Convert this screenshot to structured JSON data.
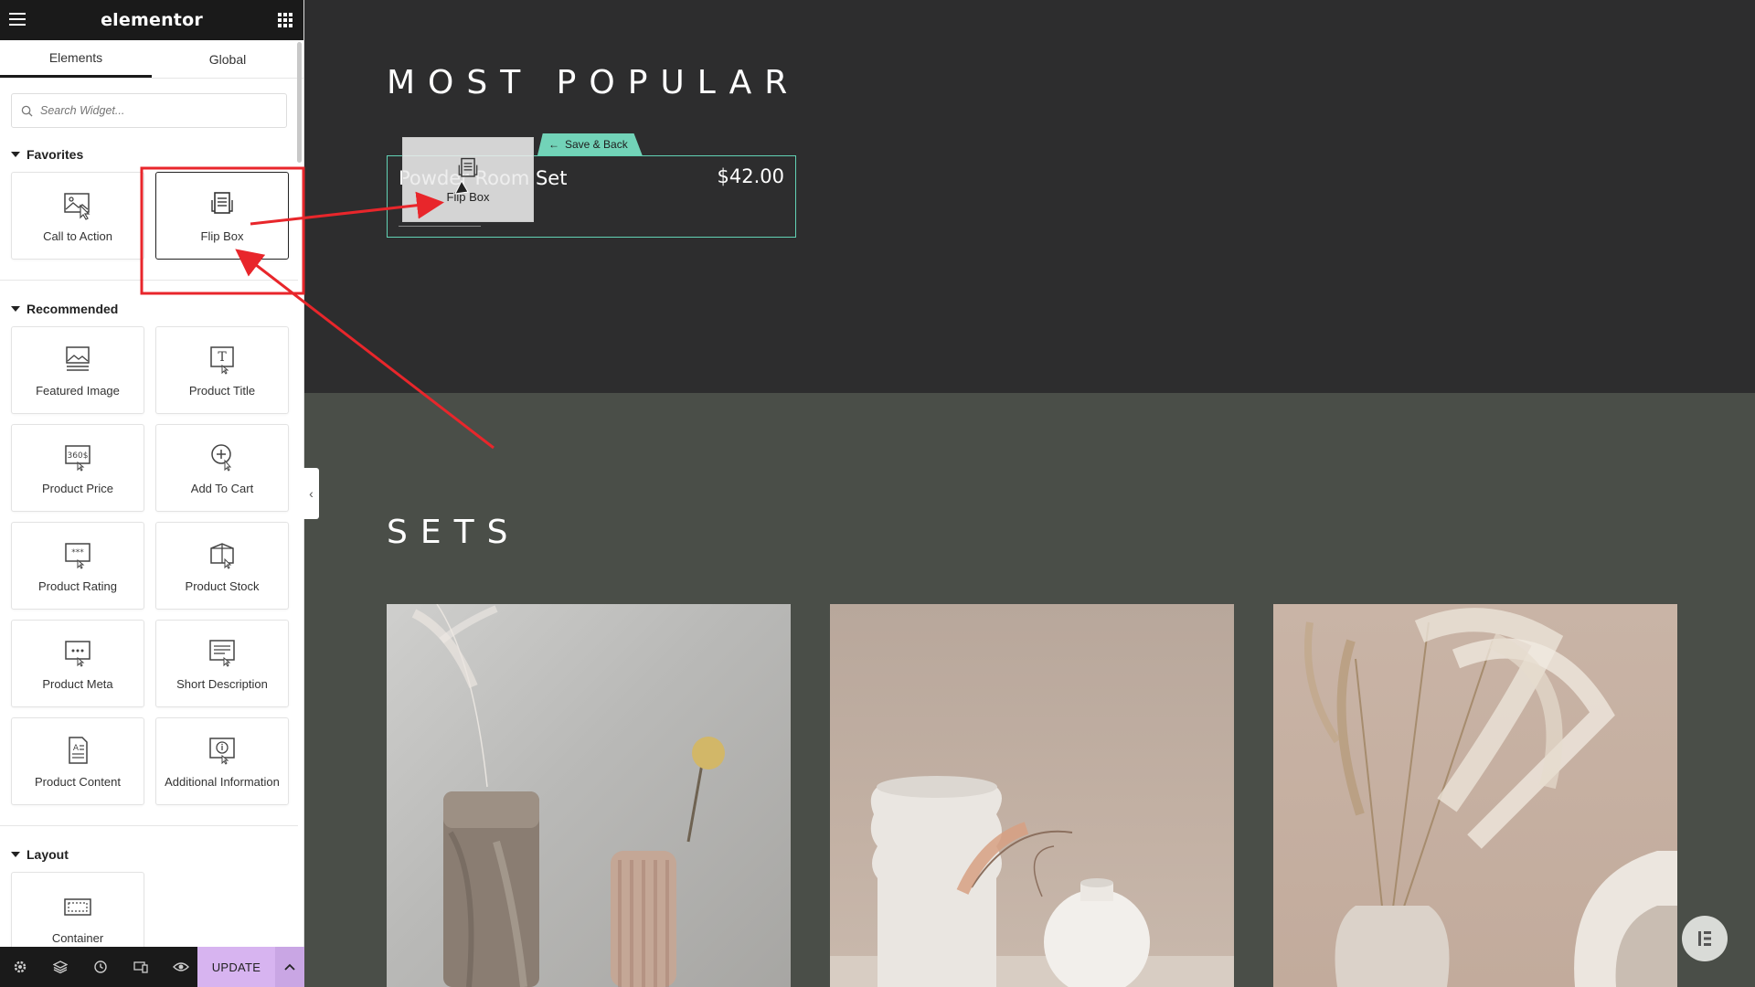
{
  "sidebar": {
    "brand": "elementor",
    "tabs": [
      {
        "label": "Elements",
        "active": true
      },
      {
        "label": "Global",
        "active": false
      }
    ],
    "search": {
      "placeholder": "Search Widget..."
    },
    "sections": {
      "favorites": {
        "title": "Favorites",
        "items": [
          {
            "label": "Call to Action",
            "icon": "call-to-action-icon"
          },
          {
            "label": "Flip Box",
            "icon": "flip-box-icon"
          }
        ]
      },
      "recommended": {
        "title": "Recommended",
        "items": [
          {
            "label": "Featured Image",
            "icon": "featured-image-icon"
          },
          {
            "label": "Product Title",
            "icon": "product-title-icon"
          },
          {
            "label": "Product Price",
            "icon": "product-price-icon"
          },
          {
            "label": "Add To Cart",
            "icon": "add-to-cart-icon"
          },
          {
            "label": "Product Rating",
            "icon": "product-rating-icon"
          },
          {
            "label": "Product Stock",
            "icon": "product-stock-icon"
          },
          {
            "label": "Product Meta",
            "icon": "product-meta-icon"
          },
          {
            "label": "Short Description",
            "icon": "short-description-icon"
          },
          {
            "label": "Product Content",
            "icon": "product-content-icon"
          },
          {
            "label": "Additional Information",
            "icon": "additional-information-icon"
          }
        ]
      },
      "layout": {
        "title": "Layout",
        "items": [
          {
            "label": "Container",
            "icon": "container-icon"
          }
        ]
      }
    },
    "footer": {
      "update_label": "UPDATE",
      "icons": [
        "settings-icon",
        "layers-icon",
        "history-icon",
        "responsive-icon",
        "preview-icon"
      ]
    }
  },
  "canvas": {
    "most_popular_heading": "MOST POPULAR",
    "product": {
      "name": "Powder Room Set",
      "price": "$42.00"
    },
    "save_back_label": "Save & Back",
    "drag_ghost_label": "Flip Box",
    "sets_heading": "SETS"
  },
  "colors": {
    "accent_teal": "#62d2b5",
    "update_purple": "#d7b4f0",
    "annotation_red": "#e8262b",
    "dark_section": "#2d2d2e",
    "green_section": "#4a4e48"
  }
}
